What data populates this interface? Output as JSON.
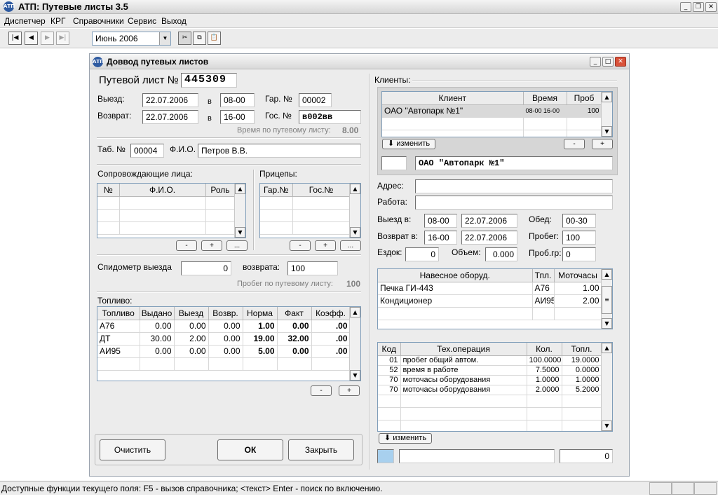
{
  "app": {
    "title": "АТП: Путевые листы 3.5"
  },
  "menu": [
    "Диспетчер",
    "КРГ",
    "Справочники",
    "Сервис",
    "Выход"
  ],
  "toolbar": {
    "period": "Июнь 2006"
  },
  "dialog": {
    "title": "Доввод путевых листов",
    "waybill_label": "Путевой лист №",
    "waybill_no": "445309",
    "depart_label": "Выезд:",
    "depart_date": "22.07.2006",
    "at": "в",
    "depart_time": "08-00",
    "return_label": "Возврат:",
    "return_date": "22.07.2006",
    "return_time": "16-00",
    "garage_label": "Гар. №",
    "garage_no": "00002",
    "plate_label": "Гос. №",
    "plate_no": "в002вв",
    "time_label": "Время по путевому листу:",
    "time_value": "8.00",
    "tab_label": "Таб. №",
    "tab_no": "00004",
    "fio_label": "Ф.И.О.",
    "fio": "Петров В.В.",
    "companions": {
      "title": "Сопровождающие лица:",
      "columns": [
        "№",
        "Ф.И.О.",
        "Роль"
      ],
      "buttons": [
        "-",
        "+",
        "..."
      ]
    },
    "trailers": {
      "title": "Прицепы:",
      "columns": [
        "Гар.№",
        "Гос.№"
      ],
      "buttons": [
        "-",
        "+",
        "..."
      ]
    },
    "speedo": {
      "depart_label": "Спидометр выезда",
      "depart_value": "0",
      "return_label": "возврата:",
      "return_value": "100",
      "run_label": "Пробег по путевому листу:",
      "run_value": "100"
    },
    "fuel": {
      "title": "Топливо:",
      "columns": [
        "Топливо",
        "Выдано",
        "Выезд",
        "Возвр.",
        "Норма",
        "Факт",
        "Коэфф."
      ],
      "rows": [
        [
          "А76",
          "0.00",
          "0.00",
          "0.00",
          "1.00",
          "0.00",
          ".00"
        ],
        [
          "ДТ",
          "30.00",
          "2.00",
          "0.00",
          "19.00",
          "32.00",
          ".00"
        ],
        [
          "АИ95",
          "0.00",
          "0.00",
          "0.00",
          "5.00",
          "0.00",
          ".00"
        ]
      ],
      "buttons": [
        "-",
        "+"
      ]
    },
    "buttons": {
      "clear": "Очистить",
      "ok": "ОК",
      "close": "Закрыть"
    },
    "clients": {
      "title": "Клиенты:",
      "columns": [
        "Клиент",
        "Время",
        "Проб"
      ],
      "rows": [
        [
          "ОАО \"Автопарк №1\"",
          "08-00  16-00",
          "100"
        ]
      ],
      "change_button": "изменить",
      "minus": "-",
      "plus": "+",
      "selected_name": "ОАО \"Автопарк №1\""
    },
    "address_label": "Адрес:",
    "work_label": "Работа:",
    "c_depart_label": "Выезд в:",
    "c_depart_time": "08-00",
    "c_depart_date": "22.07.2006",
    "c_return_label": "Возврат в:",
    "c_return_time": "16-00",
    "c_return_date": "22.07.2006",
    "lunch_label": "Обед:",
    "lunch_value": "00-30",
    "mileage_label": "Пробег:",
    "mileage_value": "100",
    "trips_label": "Ездок:",
    "trips_value": "0",
    "volume_label": "Объем:",
    "volume_value": "0.000",
    "mileage_gr_label": "Проб.гр:",
    "mileage_gr_value": "0",
    "equipment": {
      "columns": [
        "Навесное оборуд.",
        "Тпл.",
        "Моточасы"
      ],
      "rows": [
        [
          "Печка ГИ-443",
          "А76",
          "1.00"
        ],
        [
          "Кондиционер",
          "АИ95",
          "2.00"
        ]
      ]
    },
    "operations": {
      "columns": [
        "Код",
        "Тех.операция",
        "Кол.",
        "Топл."
      ],
      "rows": [
        [
          "01",
          "пробег общий автом.",
          "100.0000",
          "19.0000"
        ],
        [
          "52",
          "время в работе",
          "7.5000",
          "0.0000"
        ],
        [
          "70",
          "моточасы оборудования",
          "1.0000",
          "1.0000"
        ],
        [
          "70",
          "моточасы оборудования",
          "2.0000",
          "5.2000"
        ]
      ],
      "change_button": "изменить",
      "total": "0"
    }
  },
  "status": {
    "text": "Доступные функции текущего поля: F5 - вызов справочника; <текст> Enter - поиск по включению."
  }
}
